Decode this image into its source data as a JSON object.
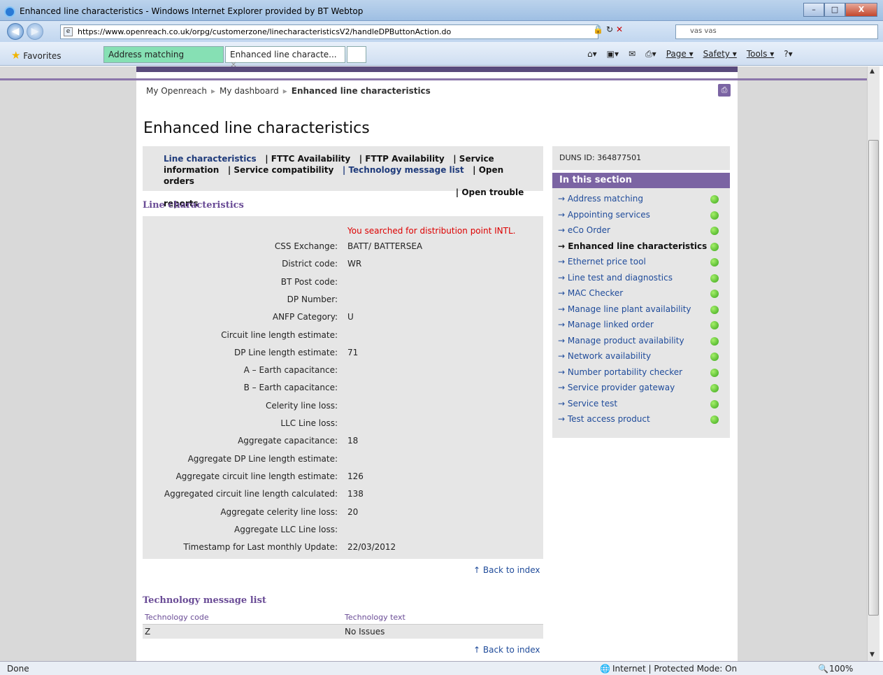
{
  "window": {
    "title": "Enhanced line characteristics - Windows Internet Explorer provided by BT Webtop",
    "min_label": "–",
    "max_label": "□",
    "close_label": "X"
  },
  "address": {
    "url": "https://www.openreach.co.uk/orpg/customerzone/linecharacteristicsV2/handleDPButtonAction.do",
    "search_value": "vas vas"
  },
  "tabs": {
    "favorites_label": "Favorites",
    "tab1": "Address matching",
    "tab2": "Enhanced line characte...",
    "tab2_close": "×"
  },
  "commandbar": {
    "page": "Page ▾",
    "safety": "Safety ▾",
    "tools": "Tools ▾"
  },
  "breadcrumb": {
    "home": "My Openreach",
    "dashboard": "My dashboard",
    "current": "Enhanced line characteristics"
  },
  "page_title": "Enhanced line characteristics",
  "section_tabs": {
    "line_characteristics": "Line characteristics",
    "fttc": "| FTTC Availability",
    "fttp": "| FTTP Availability",
    "service_info": "| Service information",
    "service_compat": "| Service compatibility",
    "tech_list": "| Technology message list",
    "open_orders": "| Open orders",
    "trouble": "| Open trouble reports"
  },
  "line_section": {
    "heading": "Line characteristics",
    "searched_msg": "You searched for distribution point INTL.",
    "rows": [
      {
        "label": "CSS Exchange:",
        "value": "BATT/ BATTERSEA"
      },
      {
        "label": "District code:",
        "value": "WR"
      },
      {
        "label": "BT Post code:",
        "value": ""
      },
      {
        "label": "DP Number:",
        "value": ""
      },
      {
        "label": "ANFP Category:",
        "value": "U"
      },
      {
        "label": "Circuit line length estimate:",
        "value": ""
      },
      {
        "label": "DP Line length estimate:",
        "value": "71"
      },
      {
        "label": "A – Earth capacitance:",
        "value": ""
      },
      {
        "label": "B – Earth capacitance:",
        "value": ""
      },
      {
        "label": "Celerity line loss:",
        "value": ""
      },
      {
        "label": "LLC Line loss:",
        "value": ""
      },
      {
        "label": "Aggregate capacitance:",
        "value": "18"
      },
      {
        "label": "Aggregate DP Line length estimate:",
        "value": ""
      },
      {
        "label": "Aggregate circuit line length estimate:",
        "value": "126"
      },
      {
        "label": "Aggregated circuit line length calculated:",
        "value": "138"
      },
      {
        "label": "Aggregate celerity line loss:",
        "value": "20"
      },
      {
        "label": "Aggregate LLC Line loss:",
        "value": ""
      },
      {
        "label": "Timestamp for Last monthly Update:",
        "value": "22/03/2012"
      }
    ],
    "back_to_index": "↑ Back to index"
  },
  "tech_section": {
    "heading": "Technology message list",
    "col_code": "Technology code",
    "col_text": "Technology text",
    "row_code": "Z",
    "row_text": "No Issues",
    "back_to_index": "↑ Back to index"
  },
  "sidebar": {
    "duns": "DUNS ID: 364877501",
    "heading": "In this section",
    "items": [
      "→ Address matching",
      "→ Appointing services",
      "→ eCo Order",
      "→ Enhanced line characteristics",
      "→ Ethernet price tool",
      "→ Line test and diagnostics",
      "→ MAC Checker",
      "→ Manage line plant availability",
      "→ Manage linked order",
      "→ Manage product availability",
      "→ Network availability",
      "→ Number portability checker",
      "→ Service provider gateway",
      "→ Service test",
      "→ Test access product"
    ]
  },
  "status": {
    "left": "Done",
    "zone": "Internet | Protected Mode: On",
    "zoom": "100%"
  },
  "colors": {
    "brand_purple": "#7b64a3",
    "status_green": "#3aa61a",
    "link_blue": "#1f4b9a"
  }
}
